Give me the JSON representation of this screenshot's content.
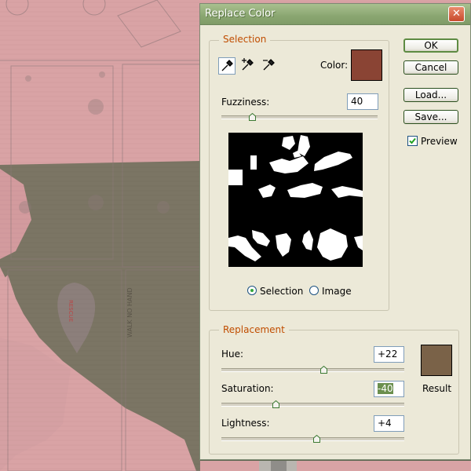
{
  "dialog": {
    "title": "Replace Color",
    "close_glyph": "✕",
    "buttons": {
      "ok": "OK",
      "cancel": "Cancel",
      "load": "Load...",
      "save": "Save..."
    },
    "preview_label": "Preview",
    "preview_checked": true
  },
  "selection": {
    "legend": "Selection",
    "tools": [
      "eyedropper-icon",
      "eyedropper-plus-icon",
      "eyedropper-minus-icon"
    ],
    "color_label": "Color:",
    "color": "#8a4434",
    "fuzziness_label": "Fuzziness:",
    "fuzziness_value": "40",
    "fuzziness_level": 0.2,
    "view_options": [
      "Selection",
      "Image"
    ],
    "view_selected": "Selection"
  },
  "replacement": {
    "legend": "Replacement",
    "hue_label": "Hue:",
    "hue_value": "+22",
    "hue_level": 0.56,
    "saturation_label": "Saturation:",
    "saturation_value": "-40",
    "saturation_level": 0.3,
    "lightness_label": "Lightness:",
    "lightness_value": "+4",
    "lightness_level": 0.52,
    "result_label": "Result",
    "result_color": "#7a6248"
  },
  "background": {
    "stencil_text_1": "RESCUE",
    "stencil_text_2": "WALK NO HAND"
  }
}
